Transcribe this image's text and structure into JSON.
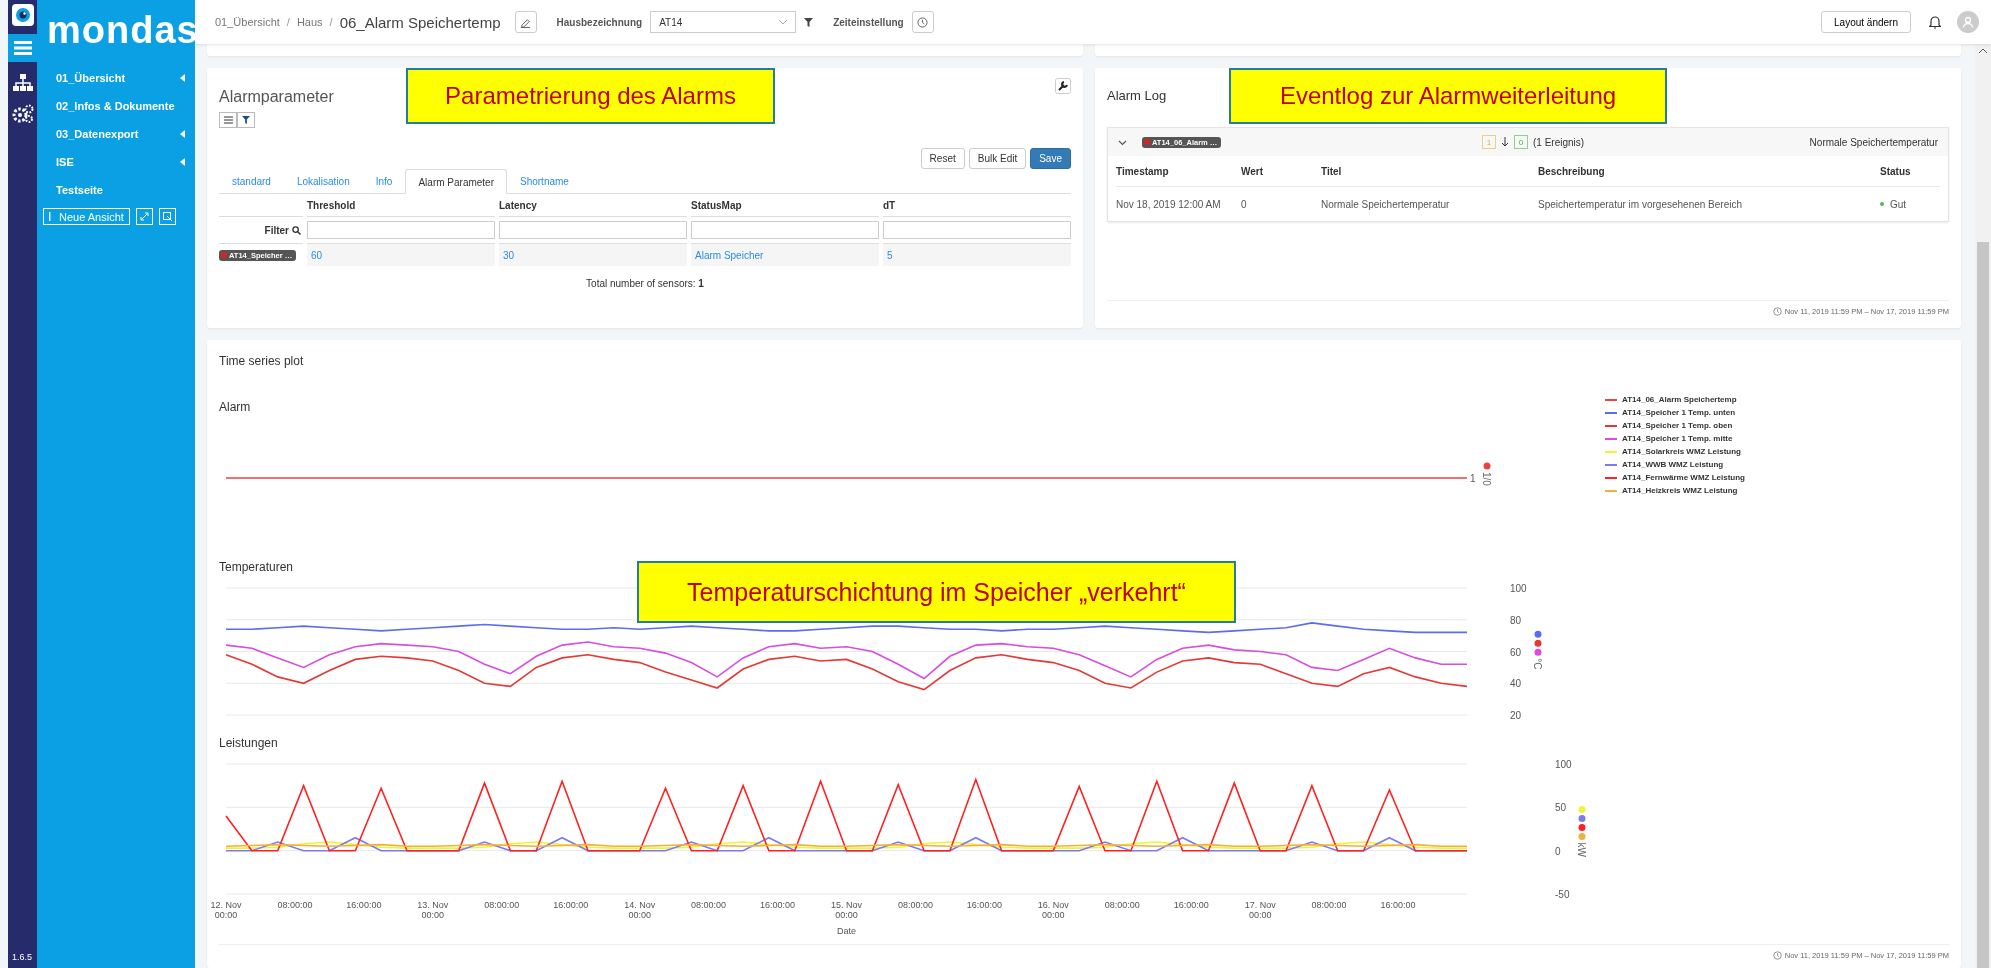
{
  "sidebar": {
    "logo": "mondas",
    "items": [
      {
        "label": "01_Übersicht",
        "expandable": true
      },
      {
        "label": "02_Infos & Dokumente",
        "expandable": false
      },
      {
        "label": "03_Datenexport",
        "expandable": true
      },
      {
        "label": "ISE",
        "expandable": true
      },
      {
        "label": "Testseite",
        "expandable": false
      }
    ],
    "new_view_button": "Neue Ansicht",
    "version": "1.6.5"
  },
  "header": {
    "breadcrumb": [
      {
        "label": "01_Übersicht",
        "separator": "/"
      },
      {
        "label": "Haus",
        "separator": "/"
      }
    ],
    "page_title": "06_Alarm Speichertemp",
    "house_label": "Hausbezeichnung",
    "house_value": "AT14",
    "time_label": "Zeiteinstellung",
    "layout_button": "Layout ändern"
  },
  "alarm_parameters": {
    "title": "Alarmparameter",
    "callout": "Parametrierung des Alarms",
    "buttons": [
      {
        "label": "Reset",
        "kind": "default"
      },
      {
        "label": "Bulk Edit",
        "kind": "default"
      },
      {
        "label": "Save",
        "kind": "primary"
      }
    ],
    "tabs": [
      {
        "label": "standard",
        "selected": false
      },
      {
        "label": "Lokalisation",
        "selected": false
      },
      {
        "label": "Info",
        "selected": false
      },
      {
        "label": "Alarm Parameter",
        "selected": true
      },
      {
        "label": "Shortname",
        "selected": false
      }
    ],
    "columns": [
      "Threshold",
      "Latency",
      "StatusMap",
      "dT"
    ],
    "filter_label": "Filter",
    "rows": [
      {
        "sensor": "AT14_Speicher …",
        "color": "#e02020",
        "cells": [
          "60",
          "30",
          "Alarm Speicher",
          "5"
        ]
      }
    ],
    "total": "Total number of sensors: **1**"
  },
  "alarm_log": {
    "title": "Alarm Log",
    "callout": "Eventlog zur Alarmweiterleitung",
    "group": {
      "sensor": "AT14_06_Alarm …",
      "color": "#e02020",
      "expanded": true,
      "count_warning": "1",
      "count_ok": "0",
      "events": "(1 Ereignis)",
      "summary": "Normale Speichertemperatur"
    },
    "columns": [
      "Timestamp",
      "Wert",
      "Titel",
      "Beschreibung",
      "Status"
    ],
    "rows": [
      {
        "cells": [
          "Nov 18, 2019 12:00 AM",
          "0",
          "Normale Speichertemperatur",
          "Speichertemperatur im vorgesehenen Bereich"
        ],
        "status": "Gut",
        "color": "#5cb85c"
      }
    ],
    "range": "Nov 11, 2019 11:59 PM – Nov 17, 2019 11:59 PM"
  },
  "time_series": {
    "title": "Time series plot",
    "callout": "Temperaturschichtung im Speicher „verkehrt“",
    "range": "Nov 11, 2019 11:59 PM – Nov 17, 2019 11:59 PM",
    "charts": [
      {
        "title": "Alarm",
        "unit": "1/0",
        "line_label": "1",
        "series": [
          {
            "name": "AT14_06_Alarm Speichertemp",
            "color": "#e8433f"
          }
        ]
      },
      {
        "title": "Temperaturen",
        "chart_data": {
          "type": "line",
          "ylabel": "°C",
          "grid": true,
          "x": [
            "2019-11-12T00:00:00",
            "2019-11-12T03:00:00",
            "2019-11-12T06:00:00",
            "2019-11-12T09:00:00",
            "2019-11-12T12:00:00",
            "2019-11-12T15:00:00",
            "2019-11-12T18:00:00",
            "2019-11-12T21:00:00",
            "2019-11-13T00:00:00",
            "2019-11-13T03:00:00",
            "2019-11-13T06:00:00",
            "2019-11-13T09:00:00",
            "2019-11-13T12:00:00",
            "2019-11-13T15:00:00",
            "2019-11-13T18:00:00",
            "2019-11-13T21:00:00",
            "2019-11-14T00:00:00",
            "2019-11-14T03:00:00",
            "2019-11-14T06:00:00",
            "2019-11-14T09:00:00",
            "2019-11-14T12:00:00",
            "2019-11-14T15:00:00",
            "2019-11-14T18:00:00",
            "2019-11-14T21:00:00",
            "2019-11-15T00:00:00",
            "2019-11-15T03:00:00",
            "2019-11-15T06:00:00",
            "2019-11-15T09:00:00",
            "2019-11-15T12:00:00",
            "2019-11-15T15:00:00",
            "2019-11-15T18:00:00",
            "2019-11-15T21:00:00",
            "2019-11-16T00:00:00",
            "2019-11-16T03:00:00",
            "2019-11-16T06:00:00",
            "2019-11-16T09:00:00",
            "2019-11-16T12:00:00",
            "2019-11-16T15:00:00",
            "2019-11-16T18:00:00",
            "2019-11-16T21:00:00",
            "2019-11-17T00:00:00",
            "2019-11-17T03:00:00",
            "2019-11-17T06:00:00",
            "2019-11-17T09:00:00",
            "2019-11-17T12:00:00",
            "2019-11-17T15:00:00",
            "2019-11-17T18:00:00",
            "2019-11-17T21:00:00",
            "2019-11-18T00:00:00"
          ],
          "xlim": [
            "2019-11-12T00:00:00",
            "2019-11-18T00:00:00"
          ],
          "ylim": [
            20,
            100
          ],
          "yticks": [
            20,
            40,
            60,
            80,
            100
          ],
          "series": [
            {
              "name": "AT14_Speicher 1 Temp. unten",
              "color": "#5b6cf0",
              "values": [
                74,
                74,
                75,
                76,
                75,
                74,
                73,
                74,
                75,
                76,
                77,
                76,
                75,
                74,
                74,
                75,
                74,
                75,
                76,
                75,
                74,
                73,
                73,
                74,
                75,
                76,
                76,
                75,
                74,
                74,
                73,
                74,
                74,
                75,
                76,
                75,
                74,
                73,
                72,
                73,
                74,
                75,
                78,
                76,
                74,
                73,
                72,
                72,
                72
              ]
            },
            {
              "name": "AT14_Speicher 1 Temp. oben",
              "color": "#e53935",
              "values": [
                58,
                52,
                44,
                40,
                48,
                55,
                57,
                56,
                54,
                48,
                40,
                38,
                50,
                56,
                58,
                55,
                53,
                47,
                42,
                37,
                49,
                55,
                57,
                54,
                55,
                49,
                41,
                36,
                48,
                56,
                58,
                55,
                53,
                48,
                40,
                37,
                47,
                54,
                56,
                53,
                52,
                46,
                40,
                38,
                46,
                50,
                44,
                40,
                38
              ]
            },
            {
              "name": "AT14_Speicher 1 Temp. mitte",
              "color": "#d84ce0",
              "values": [
                64,
                62,
                56,
                50,
                58,
                63,
                65,
                64,
                63,
                60,
                52,
                46,
                57,
                64,
                66,
                63,
                62,
                59,
                53,
                44,
                56,
                63,
                65,
                62,
                63,
                60,
                52,
                43,
                57,
                64,
                65,
                63,
                62,
                58,
                51,
                44,
                55,
                62,
                64,
                61,
                60,
                58,
                50,
                48,
                55,
                62,
                56,
                52,
                52
              ]
            }
          ]
        }
      },
      {
        "title": "Leistungen",
        "chart_data": {
          "type": "line",
          "xlabel": "Date",
          "ylabel": "kW",
          "grid": true,
          "x": [
            "2019-11-12T00:00:00",
            "2019-11-12T03:00:00",
            "2019-11-12T06:00:00",
            "2019-11-12T09:00:00",
            "2019-11-12T12:00:00",
            "2019-11-12T15:00:00",
            "2019-11-12T18:00:00",
            "2019-11-12T21:00:00",
            "2019-11-13T00:00:00",
            "2019-11-13T03:00:00",
            "2019-11-13T06:00:00",
            "2019-11-13T09:00:00",
            "2019-11-13T12:00:00",
            "2019-11-13T15:00:00",
            "2019-11-13T18:00:00",
            "2019-11-13T21:00:00",
            "2019-11-14T00:00:00",
            "2019-11-14T03:00:00",
            "2019-11-14T06:00:00",
            "2019-11-14T09:00:00",
            "2019-11-14T12:00:00",
            "2019-11-14T15:00:00",
            "2019-11-14T18:00:00",
            "2019-11-14T21:00:00",
            "2019-11-15T00:00:00",
            "2019-11-15T03:00:00",
            "2019-11-15T06:00:00",
            "2019-11-15T09:00:00",
            "2019-11-15T12:00:00",
            "2019-11-15T15:00:00",
            "2019-11-15T18:00:00",
            "2019-11-15T21:00:00",
            "2019-11-16T00:00:00",
            "2019-11-16T03:00:00",
            "2019-11-16T06:00:00",
            "2019-11-16T09:00:00",
            "2019-11-16T12:00:00",
            "2019-11-16T15:00:00",
            "2019-11-16T18:00:00",
            "2019-11-16T21:00:00",
            "2019-11-17T00:00:00",
            "2019-11-17T03:00:00",
            "2019-11-17T06:00:00",
            "2019-11-17T09:00:00",
            "2019-11-17T12:00:00",
            "2019-11-17T15:00:00",
            "2019-11-17T18:00:00",
            "2019-11-17T21:00:00",
            "2019-11-18T00:00:00"
          ],
          "xlim": [
            "2019-11-12T00:00:00",
            "2019-11-18T00:00:00"
          ],
          "ylim": [
            -50,
            100
          ],
          "yticks": [
            -50,
            0,
            50,
            100
          ],
          "xticks": [
            {
              "value": "2019-11-12T00:00:00",
              "label": "12. Nov\n00:00"
            },
            {
              "value": "2019-11-12T08:00:00",
              "label": "08:00:00"
            },
            {
              "value": "2019-11-12T16:00:00",
              "label": "16:00:00"
            },
            {
              "value": "2019-11-13T00:00:00",
              "label": "13. Nov\n00:00"
            },
            {
              "value": "2019-11-13T08:00:00",
              "label": "08:00:00"
            },
            {
              "value": "2019-11-13T16:00:00",
              "label": "16:00:00"
            },
            {
              "value": "2019-11-14T00:00:00",
              "label": "14. Nov\n00:00"
            },
            {
              "value": "2019-11-14T08:00:00",
              "label": "08:00:00"
            },
            {
              "value": "2019-11-14T16:00:00",
              "label": "16:00:00"
            },
            {
              "value": "2019-11-15T00:00:00",
              "label": "15. Nov\n00:00"
            },
            {
              "value": "2019-11-15T08:00:00",
              "label": "08:00:00"
            },
            {
              "value": "2019-11-15T16:00:00",
              "label": "16:00:00"
            },
            {
              "value": "2019-11-16T00:00:00",
              "label": "16. Nov\n00:00"
            },
            {
              "value": "2019-11-16T08:00:00",
              "label": "08:00:00"
            },
            {
              "value": "2019-11-16T16:00:00",
              "label": "16:00:00"
            },
            {
              "value": "2019-11-17T00:00:00",
              "label": "17. Nov\n00:00"
            },
            {
              "value": "2019-11-17T08:00:00",
              "label": "08:00:00"
            },
            {
              "value": "2019-11-17T16:00:00",
              "label": "16:00:00"
            }
          ],
          "series": [
            {
              "name": "AT14_Solarkreis WMZ Leistung",
              "color": "#f2f23a",
              "values": [
                3,
                3,
                4,
                8,
                10,
                7,
                4,
                3,
                3,
                3,
                4,
                8,
                10,
                7,
                4,
                3,
                3,
                3,
                4,
                8,
                10,
                7,
                4,
                3,
                3,
                3,
                4,
                8,
                10,
                7,
                4,
                3,
                3,
                3,
                4,
                8,
                10,
                7,
                4,
                3,
                3,
                3,
                4,
                8,
                10,
                7,
                4,
                3,
                3
              ]
            },
            {
              "name": "AT14_WWB WMZ Leistung",
              "color": "#7b7bf0",
              "values": [
                0,
                0,
                10,
                0,
                0,
                15,
                0,
                0,
                0,
                0,
                10,
                0,
                0,
                15,
                0,
                0,
                0,
                0,
                10,
                0,
                0,
                15,
                0,
                0,
                0,
                0,
                10,
                0,
                0,
                15,
                0,
                0,
                0,
                0,
                10,
                0,
                0,
                15,
                0,
                0,
                0,
                0,
                10,
                0,
                0,
                15,
                0,
                0,
                0
              ]
            },
            {
              "name": "AT14_Fernwärme WMZ Leistung",
              "color": "#ff2020",
              "values": [
                40,
                0,
                0,
                75,
                0,
                0,
                72,
                0,
                0,
                0,
                78,
                0,
                0,
                80,
                0,
                0,
                0,
                72,
                0,
                0,
                75,
                0,
                0,
                80,
                0,
                0,
                76,
                0,
                0,
                82,
                0,
                0,
                0,
                74,
                0,
                0,
                80,
                0,
                0,
                78,
                0,
                0,
                75,
                0,
                0,
                70,
                0,
                0,
                0
              ]
            },
            {
              "name": "AT14_Heizkreis WMZ Leistung",
              "color": "#f0b040",
              "values": [
                5,
                6,
                7,
                6,
                5,
                6,
                7,
                5,
                5,
                6,
                7,
                6,
                5,
                6,
                7,
                5,
                5,
                6,
                7,
                6,
                5,
                6,
                7,
                5,
                5,
                6,
                7,
                6,
                5,
                6,
                7,
                5,
                5,
                6,
                7,
                6,
                5,
                6,
                7,
                5,
                5,
                6,
                7,
                6,
                5,
                6,
                7,
                5,
                5
              ]
            }
          ]
        }
      }
    ]
  }
}
